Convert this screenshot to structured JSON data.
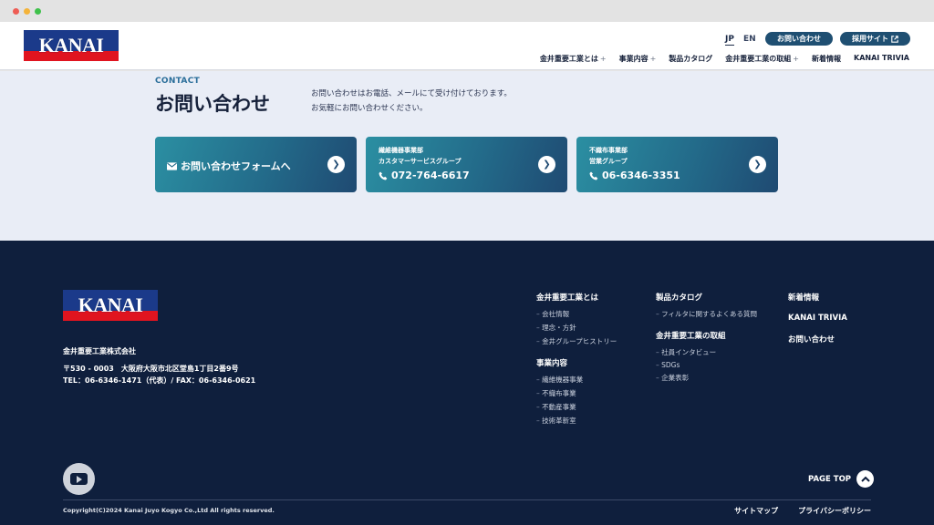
{
  "header": {
    "logo_text": "KANAI",
    "lang_jp": "JP",
    "lang_en": "EN",
    "contact_button": "お問い合わせ",
    "recruit_button": "採用サイト",
    "nav": [
      {
        "label": "金井重要工業とは",
        "has_plus": true
      },
      {
        "label": "事業内容",
        "has_plus": true
      },
      {
        "label": "製品カタログ",
        "has_plus": false
      },
      {
        "label": "金井重要工業の取組",
        "has_plus": true
      },
      {
        "label": "新着情報",
        "has_plus": false
      },
      {
        "label": "KANAI TRIVIA",
        "has_plus": false
      }
    ],
    "plus_symbol": "+"
  },
  "contact": {
    "eng_label": "CONTACT",
    "title": "お問い合わせ",
    "desc_line1": "お問い合わせはお電話、メールにて受け付けております。",
    "desc_line2": "お気軽にお問い合わせください。",
    "form_card": {
      "label": "お問い合わせフォームへ"
    },
    "card2": {
      "dept": "繊維機器事業部",
      "group": "カスタマーサービスグループ",
      "tel": "072-764-6617"
    },
    "card3": {
      "dept": "不織布事業部",
      "group": "営業グループ",
      "tel": "06-6346-3351"
    }
  },
  "footer": {
    "logo_text": "KANAI",
    "company": "金井重要工業株式会社",
    "address": "〒530 - 0003　大阪府大阪市北区堂島1丁目2番9号",
    "tel_fax": "TEL：06-6346-1471（代表）/ FAX：06-6346-0621",
    "col1": {
      "head1": "金井重要工業とは",
      "items1": [
        "会社情報",
        "理念・方針",
        "金井グループヒストリー"
      ],
      "head2": "事業内容",
      "items2": [
        "繊維機器事業",
        "不織布事業",
        "不動産事業",
        "技術革新室"
      ]
    },
    "col2": {
      "head1": "製品カタログ",
      "items1": [
        "フィルタに関するよくある質問"
      ],
      "head2": "金井重要工業の取組",
      "items2": [
        "社員インタビュー",
        "SDGs",
        "企業表彰"
      ]
    },
    "col3": [
      "新着情報",
      "KANAI TRIVIA",
      "お問い合わせ"
    ],
    "page_top": "PAGE TOP",
    "copyright": "Copyright(C)2024 Kanai Juyo Kogyo Co.,Ltd All rights reserved.",
    "sitemap": "サイトマップ",
    "privacy": "プライバシーポリシー"
  },
  "colors": {
    "navy": "#0f1f3d",
    "accent_teal": "#2b8fa2",
    "pill_blue": "#1f4f72",
    "logo_blue": "#1b3a8a",
    "logo_red": "#e0141f"
  },
  "icons": [
    "external-link-icon",
    "mail-icon",
    "phone-icon",
    "arrow-right-icon",
    "youtube-icon",
    "chevron-up-icon"
  ]
}
